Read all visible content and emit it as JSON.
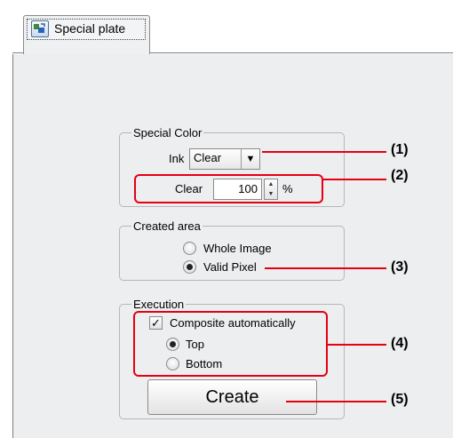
{
  "tab": {
    "label": "Special plate",
    "icon": "special-plate-icon"
  },
  "special_color": {
    "legend": "Special Color",
    "ink_label": "Ink",
    "ink_value": "Clear",
    "amount_label": "Clear",
    "amount_value": "100",
    "unit": "%"
  },
  "created_area": {
    "legend": "Created area",
    "options": [
      "Whole Image",
      "Valid Pixel"
    ],
    "selected": "Valid Pixel"
  },
  "execution": {
    "legend": "Execution",
    "composite_label": "Composite automatically",
    "composite_checked": true,
    "position_options": [
      "Top",
      "Bottom"
    ],
    "position_selected": "Top",
    "create_label": "Create"
  },
  "callouts": [
    "(1)",
    "(2)",
    "(3)",
    "(4)",
    "(5)"
  ],
  "colors": {
    "callout": "#e60012",
    "panel": "#eceeef"
  }
}
